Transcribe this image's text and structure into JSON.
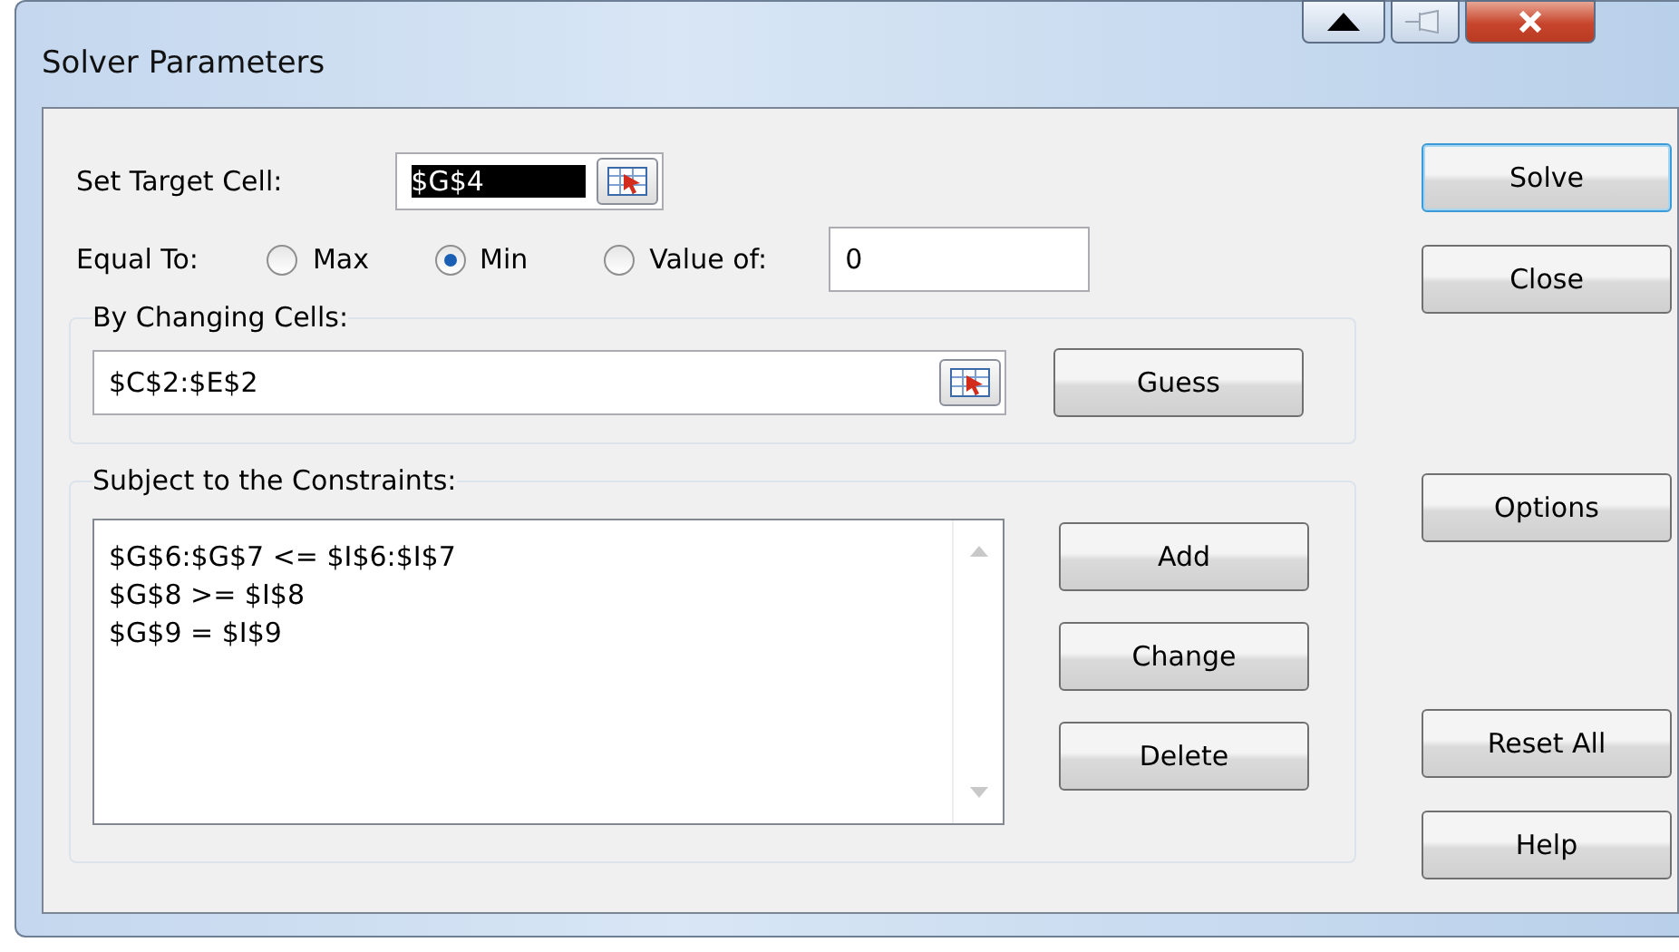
{
  "window": {
    "title": "Solver Parameters"
  },
  "target_cell": {
    "label": "Set Target Cell:",
    "value": "$G$4",
    "selected": true
  },
  "equal_to": {
    "label": "Equal To:",
    "options": [
      {
        "label": "Max",
        "selected": false
      },
      {
        "label": "Min",
        "selected": true
      },
      {
        "label": "Value of:",
        "selected": false
      }
    ],
    "value": "0"
  },
  "changing_cells": {
    "label": "By Changing Cells:",
    "value": "$C$2:$E$2",
    "button": "Guess"
  },
  "constraints": {
    "label": "Subject to the Constraints:",
    "items": [
      "$G$6:$G$7 <= $I$6:$I$7",
      "$G$8 >= $I$8",
      "$G$9 = $I$9"
    ],
    "buttons": [
      "Add",
      "Change",
      "Delete"
    ]
  },
  "side_buttons": [
    {
      "label": "Solve",
      "default": true
    },
    {
      "label": "Close",
      "default": false
    },
    {
      "label": "Options",
      "default": false
    },
    {
      "label": "Reset All",
      "default": false
    },
    {
      "label": "Help",
      "default": false
    }
  ]
}
